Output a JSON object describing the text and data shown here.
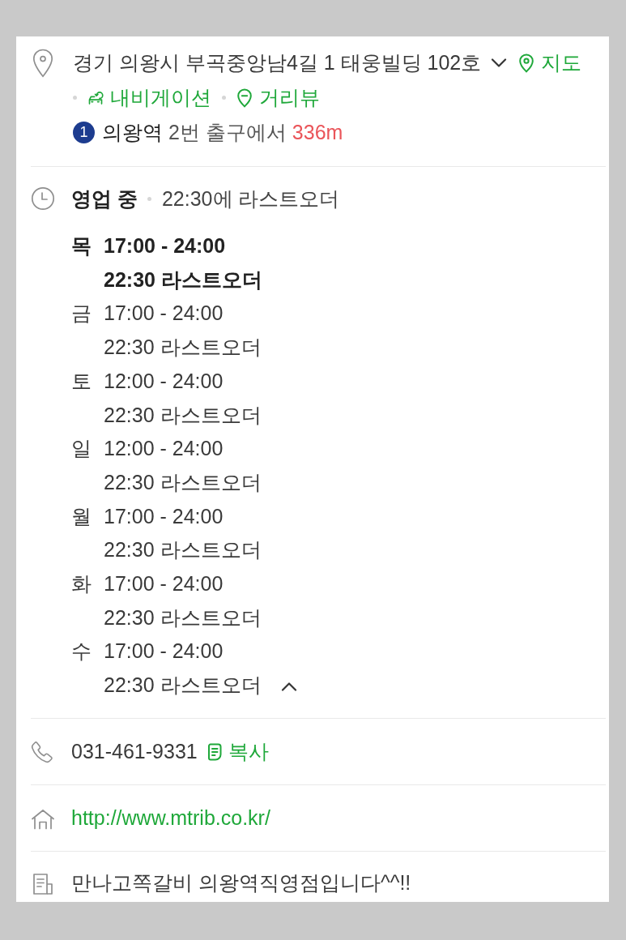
{
  "address": {
    "text": "경기 의왕시 부곡중앙남4길 1 태웅빌딩 102호",
    "expanded": false,
    "links": [
      {
        "kind": "map",
        "label": "지도"
      },
      {
        "kind": "navigation",
        "label": "내비게이션"
      },
      {
        "kind": "street_view",
        "label": "거리뷰"
      }
    ]
  },
  "directions": {
    "line": "1",
    "station": "의왕역",
    "exit": "2번 출구에서",
    "distance": "336m"
  },
  "hours": {
    "status": "영업 중",
    "note": "22:30에 라스트오더",
    "expanded": true,
    "days": [
      {
        "day": "목",
        "time": "17:00 - 24:00",
        "last_order": "22:30 라스트오더",
        "today": true
      },
      {
        "day": "금",
        "time": "17:00 - 24:00",
        "last_order": "22:30 라스트오더",
        "today": false
      },
      {
        "day": "토",
        "time": "12:00 - 24:00",
        "last_order": "22:30 라스트오더",
        "today": false
      },
      {
        "day": "일",
        "time": "12:00 - 24:00",
        "last_order": "22:30 라스트오더",
        "today": false
      },
      {
        "day": "월",
        "time": "17:00 - 24:00",
        "last_order": "22:30 라스트오더",
        "today": false
      },
      {
        "day": "화",
        "time": "17:00 - 24:00",
        "last_order": "22:30 라스트오더",
        "today": false
      },
      {
        "day": "수",
        "time": "17:00 - 24:00",
        "last_order": "22:30 라스트오더",
        "today": false
      }
    ]
  },
  "phone": {
    "number": "031-461-9331",
    "copy_label": "복사"
  },
  "website": {
    "url": "http://www.mtrib.co.kr/"
  },
  "description": {
    "text": "만나고쪽갈비 의왕역직영점입니다^^!!"
  }
}
